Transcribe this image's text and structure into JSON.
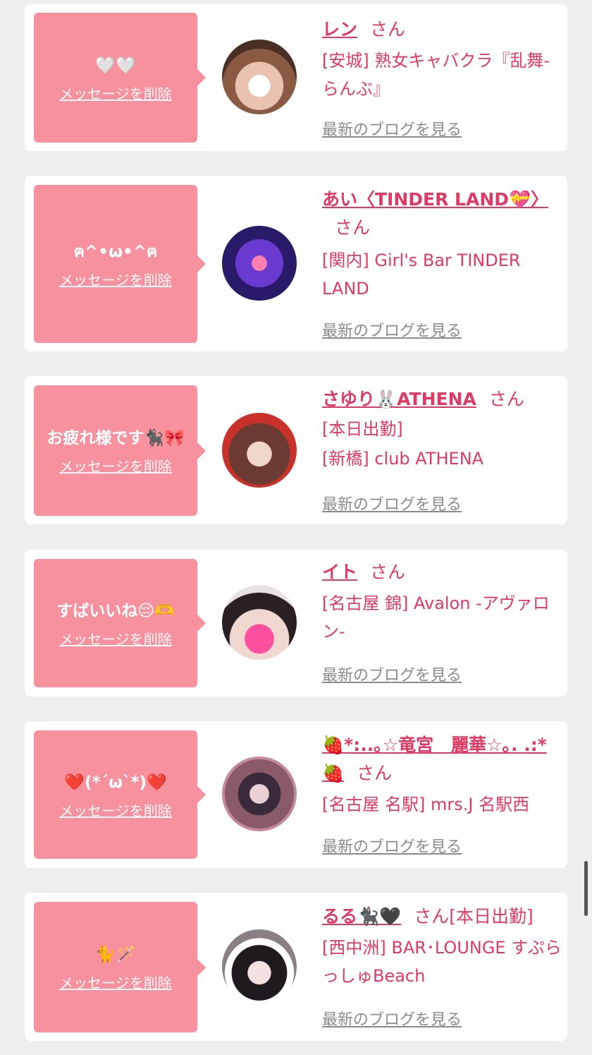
{
  "delete_label": "メッセージを削除",
  "blog_label": "最新のブログを見る",
  "honorific": "さん",
  "colors": {
    "bubble": "#f8919e",
    "accent": "#e03a64",
    "link_gray": "#8b8b8b",
    "background": "#efefef"
  },
  "entries": [
    {
      "message": "🤍🤍",
      "name": "レン",
      "extra": "",
      "shop": "[安城] 熟女キャバクラ『乱舞-らんぶ』"
    },
    {
      "message": "ฅ^•ω•^ฅ",
      "name": "あい〈TINDER LAND💝〉",
      "extra": "",
      "shop": "[関内] Girl's Bar TINDER LAND"
    },
    {
      "message": "お疲れ様です🐈‍⬛🎀",
      "name": "さゆり🐰ATHENA",
      "extra": "[本日出勤]",
      "shop": "[新橋] club ATHENA"
    },
    {
      "message": "すばいいね😔🫶",
      "name": "イト",
      "extra": "",
      "shop": "[名古屋 錦] Avalon -アヴァロン-"
    },
    {
      "message": "❤️(*´ω`*)❤️",
      "name": "🍓*:..｡☆竜宮　麗華☆｡. .:*🍓",
      "extra": "",
      "shop": "[名古屋 名駅] mrs.J 名駅西"
    },
    {
      "message": "🐈🪄",
      "name": "るる🐈‍⬛🖤",
      "extra": "[本日出勤]",
      "shop": "[西中洲] BAR･LOUNGE すぷらっしゅBeach"
    }
  ]
}
